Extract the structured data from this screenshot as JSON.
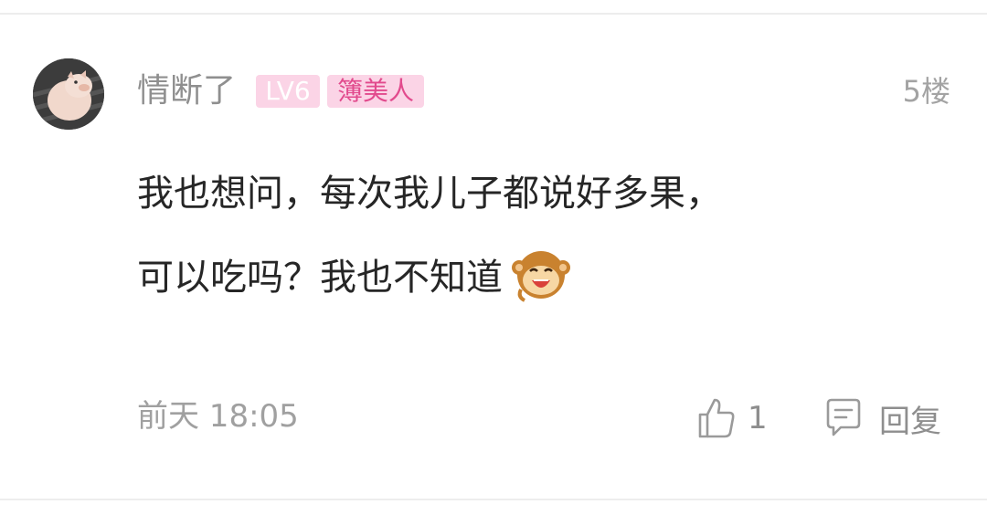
{
  "comment": {
    "username": "情断了",
    "level_badge": "LV6",
    "title_badge": "簿美人",
    "floor": "5楼",
    "content_line1": "我也想问，每次我儿子都说好多果，",
    "content_line2": "可以吃吗？我也不知道",
    "emoji": "monkey-laughing-emoji",
    "time": "前天 18:05",
    "likes": "1",
    "reply_label": "回复"
  },
  "colors": {
    "username": "#8f8f8f",
    "badge_bg": "#fbd4e6",
    "title_badge_text": "#e24a8d",
    "meta_text": "#a0a0a0",
    "content_text": "#262626"
  },
  "icons": {
    "like": "thumbs-up-icon",
    "reply": "comment-bubble-icon"
  }
}
